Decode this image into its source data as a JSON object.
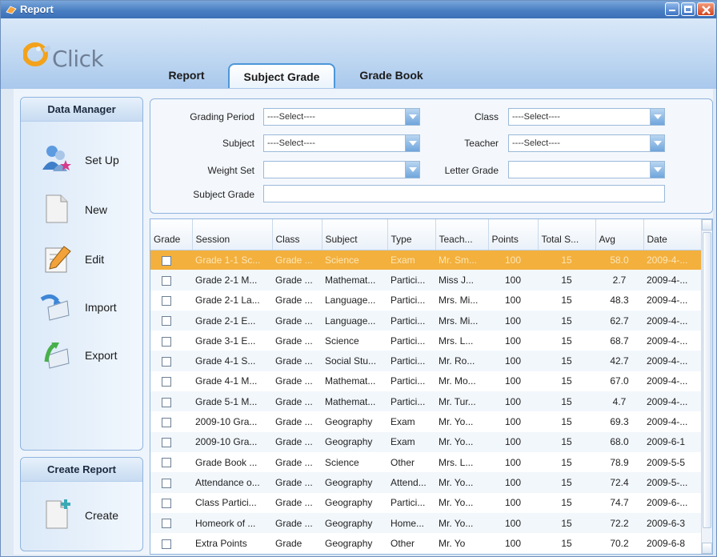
{
  "window": {
    "title": "Report"
  },
  "logo": {
    "text": "Click"
  },
  "tabs": [
    {
      "label": "Report"
    },
    {
      "label": "Subject Grade",
      "active": true
    },
    {
      "label": "Grade Book"
    }
  ],
  "data_manager": {
    "title": "Data Manager",
    "items": [
      {
        "label": "Set Up",
        "icon": "users-icon"
      },
      {
        "label": "New",
        "icon": "new-document-icon"
      },
      {
        "label": "Edit",
        "icon": "edit-pencil-icon"
      },
      {
        "label": "Import",
        "icon": "import-icon"
      },
      {
        "label": "Export",
        "icon": "export-icon"
      }
    ]
  },
  "create_report": {
    "title": "Create Report",
    "items": [
      {
        "label": "Create",
        "icon": "create-document-icon"
      }
    ]
  },
  "filters": {
    "grading_period": {
      "label": "Grading Period",
      "value": "----Select----"
    },
    "class": {
      "label": "Class",
      "value": "----Select----"
    },
    "subject": {
      "label": "Subject",
      "value": "----Select----"
    },
    "teacher": {
      "label": "Teacher",
      "value": "----Select----"
    },
    "weight_set": {
      "label": "Weight Set",
      "value": ""
    },
    "letter_grade": {
      "label": "Letter Grade",
      "value": ""
    },
    "subject_grade": {
      "label": "Subject Grade",
      "value": ""
    }
  },
  "grid": {
    "columns": [
      "Grade",
      "Session",
      "Class",
      "Subject",
      "Type",
      "Teach...",
      "Points",
      "Total S...",
      "Avg",
      "Date"
    ],
    "rows": [
      [
        "Grade 1-1 Sc...",
        "Grade ...",
        "Science",
        "Exam",
        "Mr. Sm...",
        "100",
        "15",
        "58.0",
        "2009-4-..."
      ],
      [
        "Grade 2-1 M...",
        "Grade ...",
        "Mathemat...",
        "Partici...",
        "Miss J...",
        "100",
        "15",
        "2.7",
        "2009-4-..."
      ],
      [
        "Grade 2-1 La...",
        "Grade ...",
        "Language...",
        "Partici...",
        "Mrs. Mi...",
        "100",
        "15",
        "48.3",
        "2009-4-..."
      ],
      [
        "Grade 2-1 E...",
        "Grade ...",
        "Language...",
        "Partici...",
        "Mrs. Mi...",
        "100",
        "15",
        "62.7",
        "2009-4-..."
      ],
      [
        "Grade 3-1 E...",
        "Grade ...",
        "Science",
        "Partici...",
        "Mrs. L...",
        "100",
        "15",
        "68.7",
        "2009-4-..."
      ],
      [
        "Grade 4-1 S...",
        "Grade ...",
        "Social Stu...",
        "Partici...",
        "Mr. Ro...",
        "100",
        "15",
        "42.7",
        "2009-4-..."
      ],
      [
        "Grade 4-1 M...",
        "Grade ...",
        "Mathemat...",
        "Partici...",
        "Mr. Mo...",
        "100",
        "15",
        "67.0",
        "2009-4-..."
      ],
      [
        "Grade 5-1 M...",
        "Grade ...",
        "Mathemat...",
        "Partici...",
        "Mr. Tur...",
        "100",
        "15",
        "4.7",
        "2009-4-..."
      ],
      [
        "2009-10 Gra...",
        "Grade ...",
        "Geography",
        "Exam",
        "Mr. Yo...",
        "100",
        "15",
        "69.3",
        "2009-4-..."
      ],
      [
        "2009-10 Gra...",
        "Grade ...",
        "Geography",
        "Exam",
        "Mr. Yo...",
        "100",
        "15",
        "68.0",
        "2009-6-1"
      ],
      [
        "Grade Book ...",
        "Grade ...",
        "Science",
        "Other",
        "Mrs. L...",
        "100",
        "15",
        "78.9",
        "2009-5-5"
      ],
      [
        "Attendance o...",
        "Grade ...",
        "Geography",
        "Attend...",
        "Mr. Yo...",
        "100",
        "15",
        "72.4",
        "2009-5-..."
      ],
      [
        "Class Partici...",
        "Grade ...",
        "Geography",
        "Partici...",
        "Mr. Yo...",
        "100",
        "15",
        "74.7",
        "2009-6-..."
      ],
      [
        "Homeork of ...",
        "Grade ...",
        "Geography",
        "Home...",
        "Mr. Yo...",
        "100",
        "15",
        "72.2",
        "2009-6-3"
      ],
      [
        "Extra Points",
        "Grade",
        "Geography",
        "Other",
        "Mr. Yo",
        "100",
        "15",
        "70.2",
        "2009-6-8"
      ]
    ],
    "selected_row": 0
  },
  "colors": {
    "selected_row": "#f3b03d",
    "accent": "#4d97d9",
    "title_bar": "#4a7fc4"
  }
}
